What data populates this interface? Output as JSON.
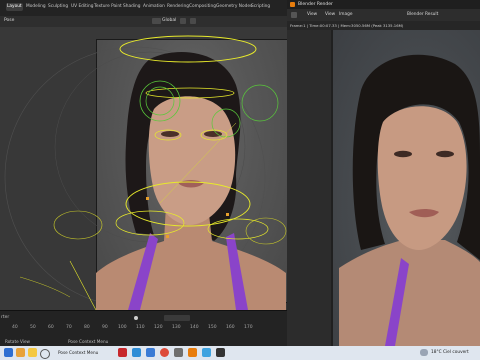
{
  "blender": {
    "workspace_tabs": [
      "Layout",
      "Modeling",
      "Sculpting",
      "UV Editing",
      "Texture Paint",
      "Shading",
      "Animation",
      "Rendering",
      "Compositing",
      "Geometry Nodes",
      "Scripting"
    ],
    "mode_label": "Pose",
    "global_label": "Global",
    "timeline": {
      "frame_label": "rter",
      "ticks": [
        "40",
        "50",
        "60",
        "70",
        "80",
        "90",
        "100",
        "110",
        "120",
        "130",
        "140",
        "150",
        "160",
        "170"
      ]
    },
    "status_left": "Rotate View",
    "status_middle": "Pose Context Menu"
  },
  "render_window": {
    "title": "Blender Render",
    "menu": [
      "View",
      "View",
      "Image"
    ],
    "slot_label": "Blender Result",
    "info": "Frame:1 | Time:00:07.33 | Mem:3050.56M (Peak 3135.16M)"
  },
  "taskbar": {
    "weather": "18°C  Ciel couvert",
    "icons": [
      "windows-start-icon",
      "search-icon",
      "task-view-icon",
      "file-explorer-icon",
      "edge-icon",
      "mail-icon",
      "chrome-icon",
      "store-icon",
      "blender-icon",
      "photos-icon",
      "unity-icon"
    ]
  },
  "colors": {
    "accent": "#4772b3",
    "rig_yellow": "#e8ea2b",
    "rig_green": "#59c93a",
    "swimsuit": "#8a44c9"
  }
}
